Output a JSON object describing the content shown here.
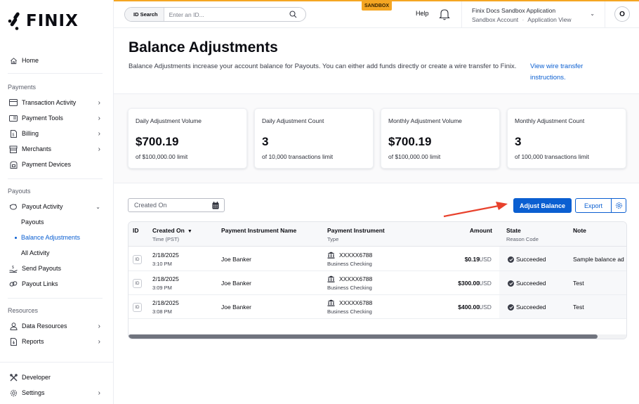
{
  "brand": {
    "name": "FINIX",
    "accent": "#0b5fd1",
    "sandbox_color": "#f5a623"
  },
  "sidebar": {
    "home": "Home",
    "sections": [
      {
        "label": "Payments",
        "items": [
          {
            "label": "Transaction Activity",
            "icon": "credit-card-icon",
            "has_chevron": true
          },
          {
            "label": "Payment Tools",
            "icon": "payment-tools-icon",
            "has_chevron": true
          },
          {
            "label": "Billing",
            "icon": "billing-icon",
            "has_chevron": true
          },
          {
            "label": "Merchants",
            "icon": "store-icon",
            "has_chevron": true
          },
          {
            "label": "Payment Devices",
            "icon": "device-icon",
            "has_chevron": false
          }
        ]
      },
      {
        "label": "Payouts",
        "items": [
          {
            "label": "Payout Activity",
            "icon": "piggy-bank-icon",
            "expanded": true,
            "children": [
              "Payouts",
              "Balance Adjustments",
              "All Activity"
            ],
            "active_child": "Balance Adjustments"
          },
          {
            "label": "Send Payouts",
            "icon": "hand-money-icon"
          },
          {
            "label": "Payout Links",
            "icon": "link-icon"
          }
        ]
      },
      {
        "label": "Resources",
        "items": [
          {
            "label": "Data Resources",
            "icon": "user-icon",
            "has_chevron": true
          },
          {
            "label": "Reports",
            "icon": "report-icon",
            "has_chevron": true
          }
        ]
      }
    ],
    "footer": [
      {
        "label": "Developer",
        "icon": "tools-icon"
      },
      {
        "label": "Settings",
        "icon": "gear-icon",
        "has_chevron": true
      }
    ]
  },
  "topbar": {
    "badge": "SANDBOX",
    "id_search": {
      "tag": "ID Search",
      "placeholder": "Enter an ID..."
    },
    "help": "Help",
    "app": {
      "name": "Finix Docs Sandbox Application",
      "account": "Sandbox Account",
      "separator": "·",
      "view": "Application View"
    },
    "avatar_initial": "O"
  },
  "page": {
    "title": "Balance Adjustments",
    "description": "Balance Adjustments increase your account balance for Payouts. You can either add funds directly or create a wire transfer to Finix.",
    "wire_link": "View wire transfer instructions."
  },
  "stats": [
    {
      "title": "Daily Adjustment Volume",
      "value": "$700.19",
      "limit": "of $100,000.00 limit"
    },
    {
      "title": "Daily Adjustment Count",
      "value": "3",
      "limit": "of 10,000 transactions limit"
    },
    {
      "title": "Monthly Adjustment Volume",
      "value": "$700.19",
      "limit": "of $100,000.00 limit"
    },
    {
      "title": "Monthly Adjustment Count",
      "value": "3",
      "limit": "of 100,000 transactions limit"
    }
  ],
  "toolbar": {
    "date_filter_placeholder": "Created On",
    "adjust_balance": "Adjust Balance",
    "export": "Export"
  },
  "table": {
    "columns": [
      {
        "label": "ID"
      },
      {
        "label": "Created On",
        "sub": "Time (PST)",
        "sorted": "desc"
      },
      {
        "label": "Payment Instrument Name"
      },
      {
        "label": "Payment Instrument",
        "sub": "Type"
      },
      {
        "label": "Amount"
      },
      {
        "label": "State",
        "sub": "Reason Code"
      },
      {
        "label": "Note"
      }
    ],
    "rows": [
      {
        "id_chip": "ID",
        "date": "2/18/2025",
        "time": "3:10 PM",
        "pi_name": "Joe Banker",
        "pi_mask": "XXXXX6788",
        "pi_type": "Business Checking",
        "amount": "$0.19",
        "currency": "USD",
        "state": "Succeeded",
        "note": "Sample balance ad"
      },
      {
        "id_chip": "ID",
        "date": "2/18/2025",
        "time": "3:09 PM",
        "pi_name": "Joe Banker",
        "pi_mask": "XXXXX6788",
        "pi_type": "Business Checking",
        "amount": "$300.00",
        "currency": "USD",
        "state": "Succeeded",
        "note": "Test"
      },
      {
        "id_chip": "ID",
        "date": "2/18/2025",
        "time": "3:08 PM",
        "pi_name": "Joe Banker",
        "pi_mask": "XXXXX6788",
        "pi_type": "Business Checking",
        "amount": "$400.00",
        "currency": "USD",
        "state": "Succeeded",
        "note": "Test"
      }
    ],
    "scroll_fraction": 0.94
  }
}
